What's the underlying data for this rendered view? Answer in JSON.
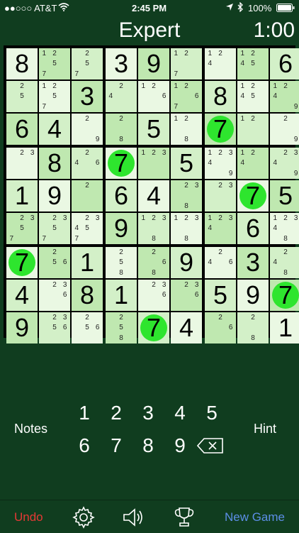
{
  "status": {
    "carrier": "●●○○○ AT&T",
    "time": "2:45 PM",
    "battery": "100%"
  },
  "header": {
    "title": "Expert",
    "timer": "1:00"
  },
  "board": {
    "rows": [
      [
        {
          "v": "8"
        },
        {
          "n": [
            "1",
            "2",
            "5",
            "7"
          ]
        },
        {
          "n": [
            "2",
            "5",
            "7"
          ]
        },
        {
          "v": "3"
        },
        {
          "v": "9"
        },
        {
          "n": [
            "1",
            "2",
            "7"
          ]
        },
        {
          "n": [
            "1",
            "2",
            "4"
          ]
        },
        {
          "n": [
            "1",
            "2",
            "4",
            "5"
          ]
        },
        {
          "v": "6"
        }
      ],
      [
        {
          "n": [
            "2",
            "5"
          ]
        },
        {
          "n": [
            "1",
            "2",
            "5",
            "7"
          ]
        },
        {
          "v": "3"
        },
        {
          "n": [
            "2",
            "4"
          ]
        },
        {
          "n": [
            "1",
            "2",
            "6"
          ]
        },
        {
          "n": [
            "1",
            "2",
            "6",
            "7"
          ]
        },
        {
          "v": "8"
        },
        {
          "n": [
            "1",
            "2",
            "4",
            "5"
          ]
        },
        {
          "n": [
            "1",
            "2",
            "4",
            "9"
          ]
        }
      ],
      [
        {
          "v": "6"
        },
        {
          "v": "4"
        },
        {
          "n": [
            "2",
            "9"
          ]
        },
        {
          "n": [
            "2",
            "8"
          ]
        },
        {
          "v": "5"
        },
        {
          "n": [
            "1",
            "2",
            "8"
          ]
        },
        {
          "v": "7",
          "c": true
        },
        {
          "n": [
            "1",
            "2"
          ]
        },
        {
          "n": [
            "2",
            "9"
          ]
        }
      ],
      [
        {
          "n": [
            "2",
            "3"
          ]
        },
        {
          "v": "8"
        },
        {
          "n": [
            "2",
            "4",
            "6"
          ]
        },
        {
          "v": "7",
          "c": true
        },
        {
          "n": [
            "1",
            "2",
            "3"
          ]
        },
        {
          "v": "5"
        },
        {
          "n": [
            "1",
            "2",
            "3",
            "4",
            "9"
          ]
        },
        {
          "n": [
            "1",
            "2",
            "4"
          ]
        },
        {
          "n": [
            "2",
            "3",
            "4",
            "9"
          ]
        }
      ],
      [
        {
          "v": "1"
        },
        {
          "v": "9"
        },
        {
          "n": [
            "2"
          ]
        },
        {
          "v": "6"
        },
        {
          "v": "4"
        },
        {
          "n": [
            "2",
            "3",
            "8"
          ]
        },
        {
          "n": [
            "2",
            "3"
          ]
        },
        {
          "v": "7",
          "c": true
        },
        {
          "v": "5"
        }
      ],
      [
        {
          "n": [
            "2",
            "3",
            "5",
            "7"
          ]
        },
        {
          "n": [
            "2",
            "3",
            "5",
            "7"
          ]
        },
        {
          "n": [
            "2",
            "3",
            "4",
            "5",
            "7"
          ]
        },
        {
          "v": "9"
        },
        {
          "n": [
            "1",
            "2",
            "3",
            "8"
          ]
        },
        {
          "n": [
            "1",
            "2",
            "3",
            "8"
          ]
        },
        {
          "n": [
            "1",
            "2",
            "3",
            "4"
          ]
        },
        {
          "v": "6"
        },
        {
          "n": [
            "1",
            "2",
            "3",
            "4",
            "8"
          ]
        }
      ],
      [
        {
          "v": "7",
          "c": true
        },
        {
          "n": [
            "2",
            "5",
            "6"
          ]
        },
        {
          "v": "1"
        },
        {
          "n": [
            "2",
            "5",
            "8"
          ]
        },
        {
          "n": [
            "2",
            "6",
            "8"
          ]
        },
        {
          "v": "9"
        },
        {
          "n": [
            "2",
            "4",
            "6"
          ]
        },
        {
          "v": "3"
        },
        {
          "n": [
            "2",
            "4",
            "8"
          ]
        }
      ],
      [
        {
          "v": "4"
        },
        {
          "n": [
            "2",
            "3",
            "6"
          ]
        },
        {
          "v": "8"
        },
        {
          "v": "1"
        },
        {
          "n": [
            "2",
            "3",
            "6"
          ]
        },
        {
          "n": [
            "2",
            "3",
            "6"
          ]
        },
        {
          "v": "5"
        },
        {
          "v": "9"
        },
        {
          "v": "7",
          "c": true
        }
      ],
      [
        {
          "v": "9"
        },
        {
          "n": [
            "2",
            "3",
            "5",
            "6"
          ]
        },
        {
          "n": [
            "2",
            "5",
            "6"
          ]
        },
        {
          "n": [
            "2",
            "5",
            "8"
          ]
        },
        {
          "v": "7",
          "c": true
        },
        {
          "v": "4"
        },
        {
          "n": [
            "2",
            "6"
          ]
        },
        {
          "n": [
            "2",
            "8"
          ]
        },
        {
          "v": "1"
        }
      ]
    ]
  },
  "keypad": {
    "notes_label": "Notes",
    "hint_label": "Hint",
    "row1": [
      "1",
      "2",
      "3",
      "4",
      "5"
    ],
    "row2": [
      "6",
      "7",
      "8",
      "9"
    ]
  },
  "bottom": {
    "undo_label": "Undo",
    "new_game_label": "New Game"
  },
  "colors": {
    "background": "#103d1f",
    "highlight_circle": "#2ee52e",
    "undo": "#e53935",
    "new_game": "#5c8ee6"
  },
  "icons": [
    "wifi-icon",
    "location-icon",
    "bluetooth-icon",
    "battery-icon",
    "backspace-icon",
    "settings-gear-icon",
    "speaker-icon",
    "trophy-icon"
  ]
}
